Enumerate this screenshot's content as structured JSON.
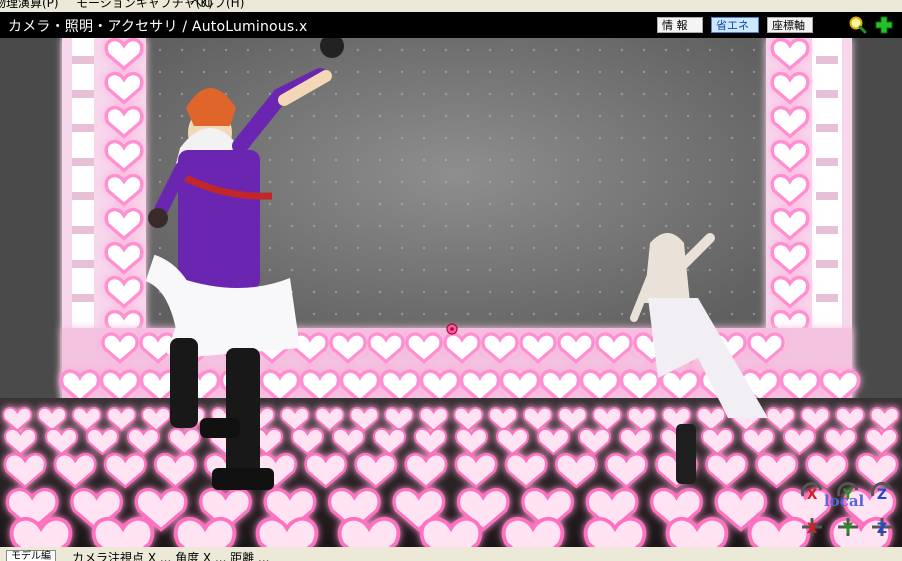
{
  "menu": {
    "items": [
      "物理演算(P)",
      "モーションキャプチャ(K)",
      "ヘルプ(H)"
    ]
  },
  "titlebar": {
    "title": "カメラ・照明・アクセサリ / AutoLuminous.x",
    "buttons": [
      "情 報",
      "省エネ",
      "座標軸"
    ],
    "active_button": "省エネ",
    "icons": [
      "zoom-icon",
      "move-plus-icon"
    ]
  },
  "viewport": {
    "mode_label": "local",
    "axis_labels": [
      "X",
      "Y",
      "Z"
    ],
    "colors": {
      "x_axis": "#d32020",
      "y_axis": "#1c9a1c",
      "z_axis": "#2046d8",
      "heart_glow": "#ff8fd0"
    }
  },
  "bottom": {
    "tab_label": "モデル編",
    "status_text": "カメラ注視点 X ... 角度 X ... 距離 ..."
  }
}
